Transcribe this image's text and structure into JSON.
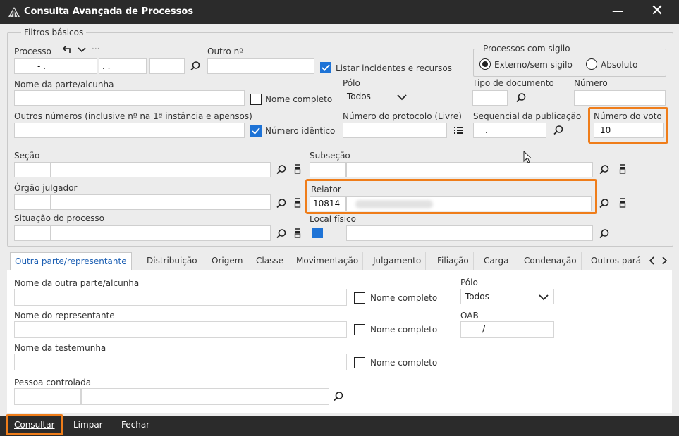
{
  "window": {
    "title": "Consulta Avançada de Processos",
    "min": "—",
    "close": "✕"
  },
  "basic": {
    "group_label": "Filtros básicos",
    "processo_label": "Processo",
    "processo_part1": "- .",
    "processo_part2": ". .",
    "processo_more": "···",
    "outro_label": "Outro nº",
    "listar_label": "Listar incidentes e recursos",
    "sigilo_group": "Processos com sigilo",
    "sigilo_externo": "Externo/sem sigilo",
    "sigilo_absoluto": "Absoluto",
    "nome_parte_label": "Nome da parte/alcunha",
    "nome_completo": "Nome completo",
    "polo_label": "Pólo",
    "polo_value": "Todos",
    "tipo_doc_label": "Tipo de documento",
    "numero_label": "Número",
    "outros_numeros_label": "Outros números  (inclusive nº na 1ª instância e apensos)",
    "numero_identico": "Número idêntico",
    "protocolo_label": "Número do protocolo (Livre)",
    "sequencial_label": "Sequencial da publicação",
    "sequencial_value": ".",
    "voto_label": "Número do voto",
    "voto_value": "10",
    "secao_label": "Seção",
    "subsecao_label": "Subseção",
    "orgao_label": "Órgão julgador",
    "relator_label": "Relator",
    "relator_code": "10814",
    "situacao_label": "Situação do processo",
    "local_label": "Local físico"
  },
  "tabs": [
    "Outra parte/representante",
    "Distribuição",
    "Origem",
    "Classe",
    "Movimentação",
    "Julgamento",
    "Filiação",
    "Carga",
    "Condenação",
    "Outros pará"
  ],
  "panel": {
    "outra_parte_label": "Nome da outra parte/alcunha",
    "nome_completo": "Nome completo",
    "polo_label": "Pólo",
    "polo_value": "Todos",
    "representante_label": "Nome do representante",
    "oab_label": "OAB",
    "oab_value": "/",
    "testemunha_label": "Nome da testemunha",
    "pessoa_label": "Pessoa controlada"
  },
  "bottom": {
    "consultar": "Consultar",
    "limpar": "Limpar",
    "fechar": "Fechar"
  },
  "colors": {
    "accent": "#1e73d6",
    "highlight": "#ef7d1a",
    "titlebar": "#2b2b2b"
  }
}
